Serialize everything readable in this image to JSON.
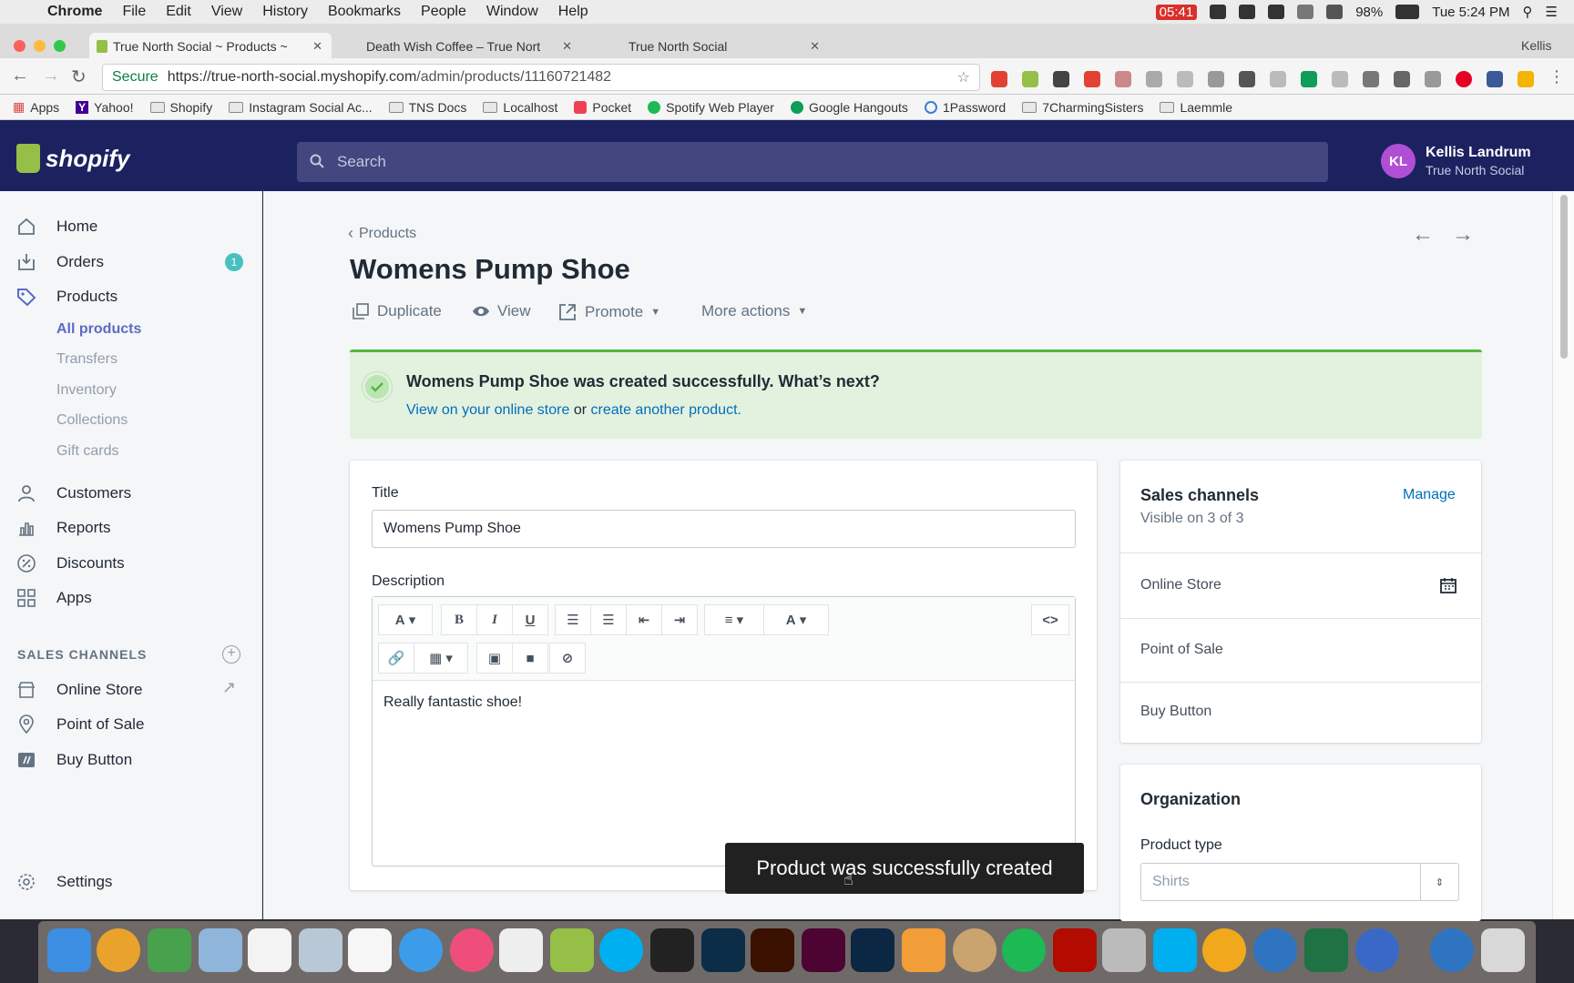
{
  "menubar": {
    "app": "Chrome",
    "items": [
      "File",
      "Edit",
      "View",
      "History",
      "Bookmarks",
      "People",
      "Window",
      "Help"
    ],
    "timer": "05:41",
    "battery": "98%",
    "clock": "Tue 5:24 PM"
  },
  "browser": {
    "profile": "Kellis",
    "tabs": [
      {
        "title": "True North Social ~ Products ~"
      },
      {
        "title": "Death Wish Coffee – True Nort"
      },
      {
        "title": "True North Social"
      }
    ],
    "secure_label": "Secure",
    "url_host": "https://true-north-social.myshopify.com",
    "url_path": "/admin/products/11160721482",
    "bookmarks": [
      "Apps",
      "Yahoo!",
      "Shopify",
      "Instagram Social Ac...",
      "TNS Docs",
      "Localhost",
      "Pocket",
      "Spotify Web Player",
      "Google Hangouts",
      "1Password",
      "7CharmingSisters",
      "Laemmle"
    ]
  },
  "header": {
    "logo_text": "shopify",
    "search_placeholder": "Search",
    "avatar_initials": "KL",
    "user_name": "Kellis Landrum",
    "store_name": "True North Social"
  },
  "sidebar": {
    "nav": [
      {
        "label": "Home"
      },
      {
        "label": "Orders",
        "badge": "1"
      },
      {
        "label": "Products"
      },
      {
        "label": "Customers"
      },
      {
        "label": "Reports"
      },
      {
        "label": "Discounts"
      },
      {
        "label": "Apps"
      }
    ],
    "products_sub": [
      "All products",
      "Transfers",
      "Inventory",
      "Collections",
      "Gift cards"
    ],
    "sales_channels_heading": "SALES CHANNELS",
    "channels": [
      "Online Store",
      "Point of Sale",
      "Buy Button"
    ],
    "settings": "Settings"
  },
  "page": {
    "breadcrumb": "Products",
    "title": "Womens Pump Shoe",
    "actions": {
      "duplicate": "Duplicate",
      "view": "View",
      "promote": "Promote",
      "more": "More actions"
    },
    "banner": {
      "message": "Womens Pump Shoe was created successfully. What’s next?",
      "link1": "View on your online store",
      "or": "or",
      "link2": "create another product."
    },
    "form": {
      "title_label": "Title",
      "title_value": "Womens Pump Shoe",
      "description_label": "Description",
      "description_value": "Really fantastic shoe!"
    },
    "sales_channels": {
      "heading": "Sales channels",
      "manage": "Manage",
      "visibility": "Visible on 3 of 3",
      "items": [
        "Online Store",
        "Point of Sale",
        "Buy Button"
      ]
    },
    "organization": {
      "heading": "Organization",
      "product_type_label": "Product type",
      "product_type_placeholder": "Shirts"
    },
    "toast": "Product was successfully created"
  },
  "colors": {
    "shopify_nav": "#1c2260",
    "accent": "#5c6ac4",
    "success_bg": "#e3f1df",
    "success_border": "#50b83c",
    "link": "#006fbb"
  }
}
